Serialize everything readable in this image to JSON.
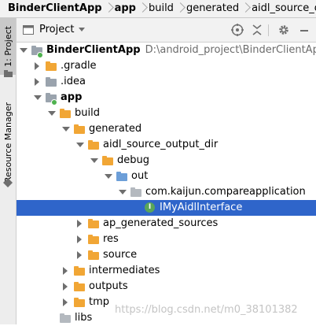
{
  "breadcrumb": {
    "items": [
      {
        "label": "BinderClientApp"
      },
      {
        "label": "app"
      },
      {
        "label": "build"
      },
      {
        "label": "generated"
      },
      {
        "label": "aidl_source_output_"
      }
    ]
  },
  "left_tool_strip": {
    "tabs": [
      {
        "label": "1: Project"
      },
      {
        "label": "Resource Manager"
      }
    ]
  },
  "project_panel": {
    "view_selector": "Project",
    "icons": [
      "globe-icon",
      "collapse-all-icon",
      "gear-icon",
      "minimize-icon"
    ]
  },
  "tree": [
    {
      "label": "BinderClientApp",
      "path": "D:\\android_project\\BinderClientApp",
      "depth": 0,
      "expanded": true,
      "icon": "module-folder",
      "bold": true
    },
    {
      "label": ".gradle",
      "depth": 1,
      "expanded": false,
      "icon": "folder-orange"
    },
    {
      "label": ".idea",
      "depth": 1,
      "expanded": false,
      "icon": "folder-gray"
    },
    {
      "label": "app",
      "depth": 1,
      "expanded": true,
      "icon": "module-folder",
      "bold": true
    },
    {
      "label": "build",
      "depth": 2,
      "expanded": true,
      "icon": "folder-orange"
    },
    {
      "label": "generated",
      "depth": 3,
      "expanded": true,
      "icon": "folder-orange"
    },
    {
      "label": "aidl_source_output_dir",
      "depth": 4,
      "expanded": true,
      "icon": "folder-orange"
    },
    {
      "label": "debug",
      "depth": 5,
      "expanded": true,
      "icon": "folder-orange"
    },
    {
      "label": "out",
      "depth": 6,
      "expanded": true,
      "icon": "source-folder"
    },
    {
      "label": "com.kaijun.compareapplication",
      "depth": 7,
      "expanded": true,
      "icon": "package-folder"
    },
    {
      "label": "IMyAidlInterface",
      "depth": 8,
      "icon": "interface",
      "selected": true
    },
    {
      "label": "ap_generated_sources",
      "depth": 4,
      "expanded": false,
      "icon": "folder-orange"
    },
    {
      "label": "res",
      "depth": 4,
      "expanded": false,
      "icon": "folder-orange"
    },
    {
      "label": "source",
      "depth": 4,
      "expanded": false,
      "icon": "folder-orange"
    },
    {
      "label": "intermediates",
      "depth": 3,
      "expanded": false,
      "icon": "folder-orange"
    },
    {
      "label": "outputs",
      "depth": 3,
      "expanded": false,
      "icon": "folder-orange"
    },
    {
      "label": "tmp",
      "depth": 3,
      "expanded": false,
      "icon": "folder-orange"
    },
    {
      "label": "libs",
      "depth": 2,
      "icon": "folder-plain"
    }
  ],
  "interface_badge": "I",
  "watermark": "https://blog.csdn.net/m0_38101382",
  "colors": {
    "selection": "#2f65ca",
    "folder": "#f1a635"
  }
}
